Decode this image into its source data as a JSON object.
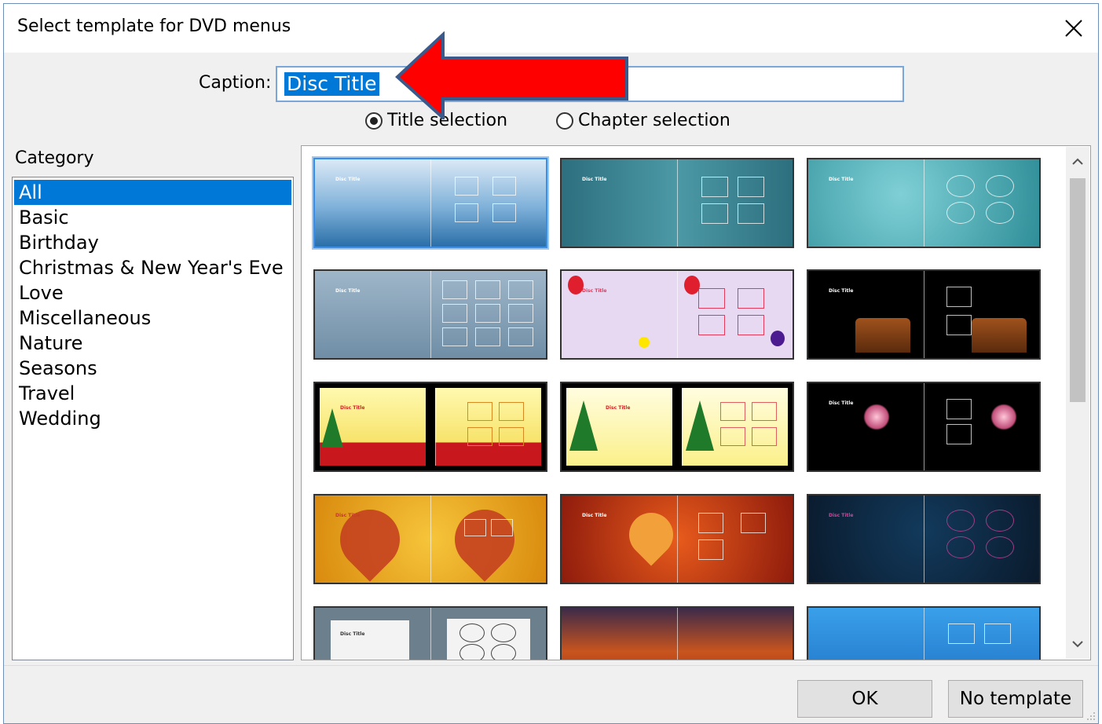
{
  "window": {
    "title": "Select template for DVD menus"
  },
  "caption": {
    "label": "Caption:",
    "value": "Disc Title"
  },
  "radios": [
    {
      "label": "Title selection",
      "checked": true
    },
    {
      "label": "Chapter selection",
      "checked": false
    }
  ],
  "category": {
    "label": "Category",
    "items": [
      "All",
      "Basic",
      "Birthday",
      "Christmas & New Year's Eve",
      "Love",
      "Miscellaneous",
      "Nature",
      "Seasons",
      "Travel",
      "Wedding"
    ],
    "selected": "All"
  },
  "templates": [
    {
      "name": "blue-waves",
      "title": "Disc Title"
    },
    {
      "name": "teal-stripes",
      "title": "Disc Title"
    },
    {
      "name": "aqua-clouds",
      "title": "Disc Title"
    },
    {
      "name": "grey-blue",
      "title": "Disc Title"
    },
    {
      "name": "balloons",
      "title": "Disc Title"
    },
    {
      "name": "birthday-cake",
      "title": "Disc Title"
    },
    {
      "name": "christmas-red",
      "title": "Disc Title"
    },
    {
      "name": "christmas-yellow",
      "title": "Disc Title"
    },
    {
      "name": "fireworks",
      "title": "Disc Title"
    },
    {
      "name": "love-gold-heart",
      "title": "Disc Title"
    },
    {
      "name": "love-red-heart",
      "title": "Disc Title"
    },
    {
      "name": "dark-blue-swirl",
      "title": "Disc Title"
    },
    {
      "name": "grey-frames",
      "title": "Disc Title"
    },
    {
      "name": "orange-sky",
      "title": ""
    },
    {
      "name": "blue-skyline",
      "title": ""
    }
  ],
  "buttons": {
    "ok": "OK",
    "no_template": "No template"
  },
  "colors": {
    "accent": "#0078d7",
    "arrow": "#ff0000",
    "arrow_border": "#3a5a8c"
  }
}
